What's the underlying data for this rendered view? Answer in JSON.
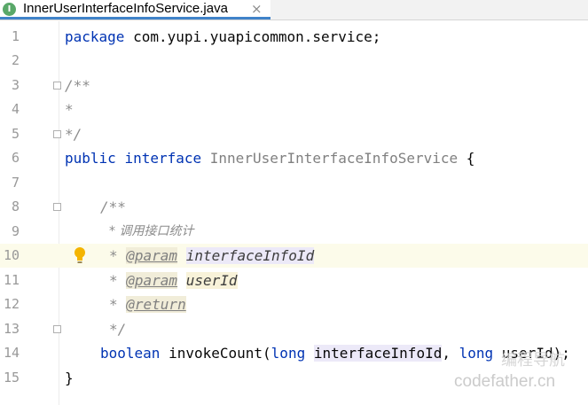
{
  "tab": {
    "title": "InnerUserInterfaceInfoService.java",
    "close": "×",
    "icon_letter": "I"
  },
  "code": {
    "l1": {
      "kw": "package",
      "rest": " com.yupi.yuapicommon.service;"
    },
    "l3": "/**",
    "l4": "*",
    "l5": "*/",
    "l6": {
      "kw1": "public",
      "kw2": "interface",
      "name": "InnerUserInterfaceInfoService",
      "brace": " {"
    },
    "l8": "/**",
    "l9": "* 调用接口统计",
    "l10": {
      "star": "* ",
      "tag": "@param",
      "param": "interfaceInfoId"
    },
    "l11": {
      "star": "* ",
      "tag": "@param",
      "param": "userId"
    },
    "l12": {
      "star": "* ",
      "tag": "@return"
    },
    "l13": "*/",
    "l14": {
      "kw": "boolean",
      "method": " invokeCount(",
      "kw2": "long",
      "p1": "interfaceInfoId",
      "sep": ", ",
      "kw3": "long",
      "p2": "userId",
      "end": ");"
    },
    "l15": "}"
  },
  "line_numbers": [
    "1",
    "2",
    "3",
    "4",
    "5",
    "6",
    "7",
    "8",
    "9",
    "10",
    "11",
    "12",
    "13",
    "14",
    "15"
  ],
  "watermark": {
    "line1": "编程导航",
    "line2": "codefather.cn"
  }
}
